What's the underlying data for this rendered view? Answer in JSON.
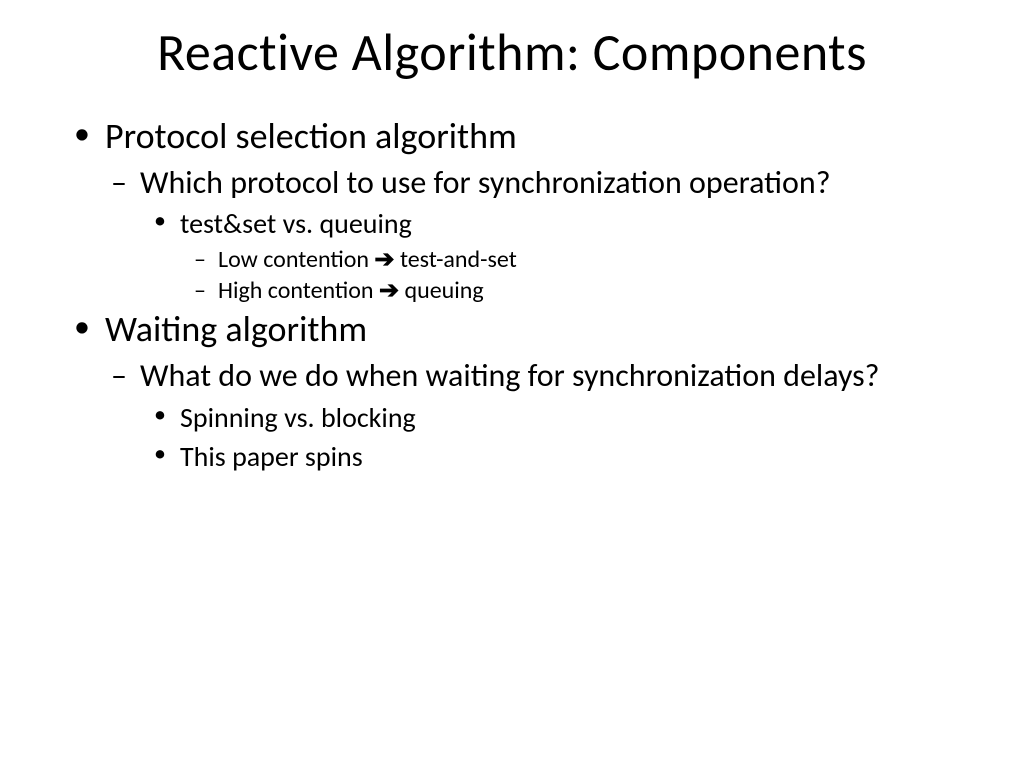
{
  "slide": {
    "title": "Reactive Algorithm: Components",
    "bullets": {
      "item1": "Protocol selection algorithm",
      "item1_1": "Which protocol to use for synchronization operation?",
      "item1_1_1": "test&set vs. queuing",
      "item1_1_1_1_pre": "Low contention ",
      "item1_1_1_1_post": " test-and-set",
      "item1_1_1_2_pre": "High contention ",
      "item1_1_1_2_post": " queuing",
      "item2": "Waiting algorithm",
      "item2_1": "What do we do when waiting for synchronization delays?",
      "item2_1_1": "Spinning vs. blocking",
      "item2_1_2": "This paper spins"
    },
    "arrow": "➔"
  }
}
